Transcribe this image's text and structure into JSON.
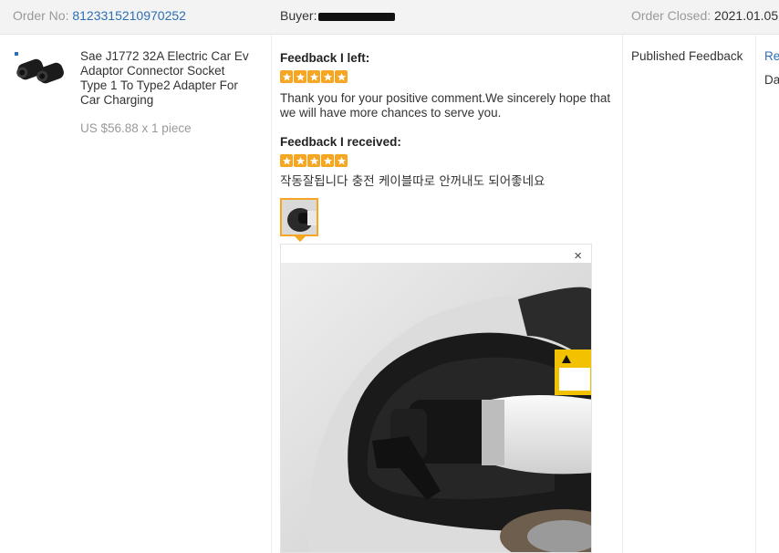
{
  "header": {
    "order_label": "Order No:",
    "order_number": "8123315210970252",
    "buyer_label": "Buyer:",
    "closed_label": "Order Closed:",
    "closed_date": "2021.01.05 ..."
  },
  "product": {
    "title": "Sae J1772 32A Electric Car Ev Adaptor Connector Socket Type 1 To Type2 Adapter For Car Charging",
    "price": "US $56.88 x 1 piece"
  },
  "feedback": {
    "left_heading": "Feedback I left:",
    "left_stars": 5,
    "left_text": "Thank you for your positive comment.We sincerely hope that we will have more chances to serve you.",
    "received_heading": "Feedback I received:",
    "received_stars": 5,
    "received_text": "작동잘됩니다 충전 케이블따로 안꺼내도 되어좋네요",
    "close_symbol": "×"
  },
  "status": {
    "published": "Published Feedback",
    "cut_link": "Re",
    "cut_text": "Da"
  },
  "colors": {
    "star": "#f5a623",
    "link": "#2c6fb5",
    "header_bg": "#f3f3f3"
  }
}
